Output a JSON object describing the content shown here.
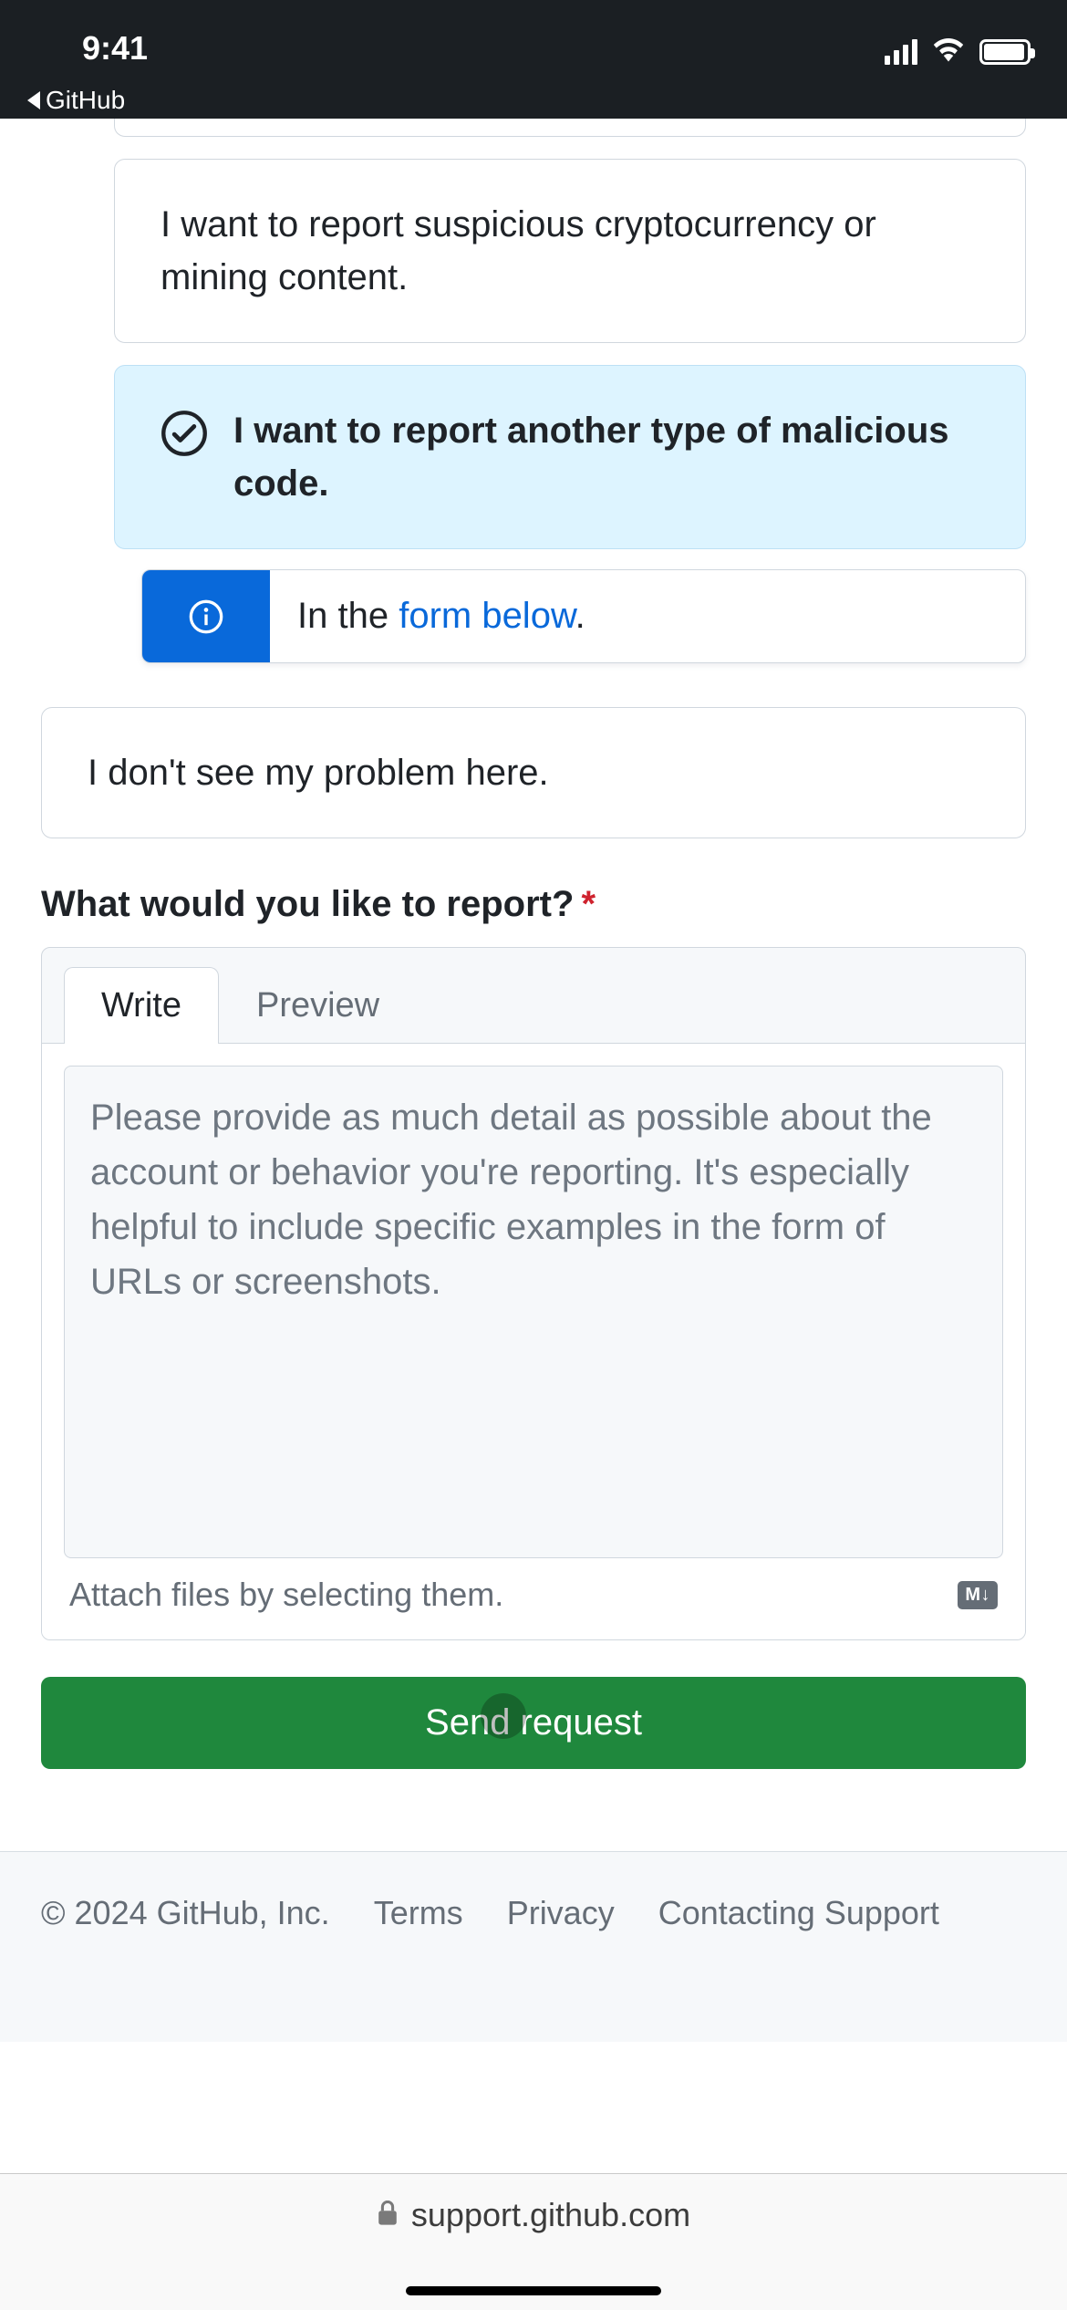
{
  "status_bar": {
    "time": "9:41",
    "back_app": "GitHub"
  },
  "options": {
    "crypto": "I want to report suspicious cryptocurrency or mining content.",
    "other_malicious": "I want to report another type of malicious code.",
    "info_prefix": "In the ",
    "info_link": "form below",
    "info_suffix": ".",
    "not_listed": "I don't see my problem here."
  },
  "form": {
    "label": "What would you like to report?",
    "tabs": {
      "write": "Write",
      "preview": "Preview"
    },
    "placeholder": "Please provide as much detail as possible about the account or behavior you're reporting. It's especially helpful to include specific examples in the form of URLs or screenshots.",
    "attach_hint": "Attach files by selecting them.",
    "md_badge": "M↓",
    "submit": "Send request"
  },
  "footer": {
    "copyright": "© 2024 GitHub, Inc.",
    "terms": "Terms",
    "privacy": "Privacy",
    "contact": "Contacting Support"
  },
  "browser": {
    "url": "support.github.com"
  }
}
